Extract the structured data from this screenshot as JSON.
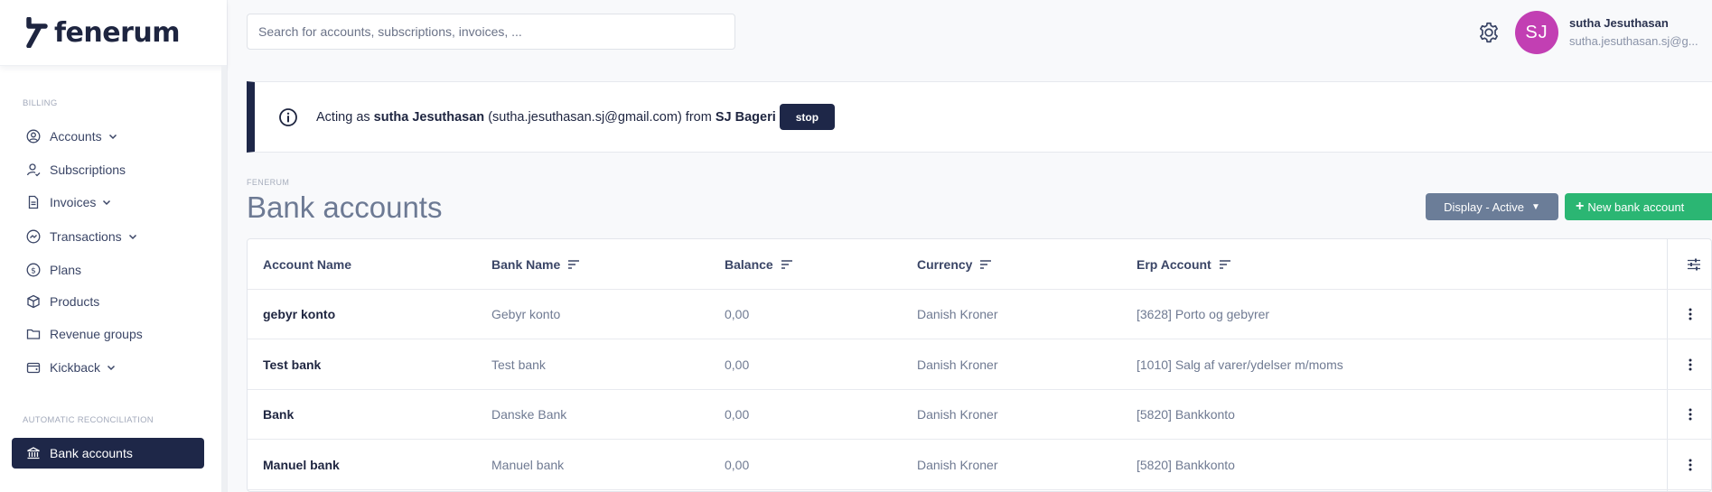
{
  "app": {
    "logo_text": "fenerum",
    "brand_color": "#1e2748",
    "accent_green": "#2bb673",
    "avatar_color": "#c23fb3"
  },
  "search": {
    "placeholder": "Search for accounts, subscriptions, invoices, ..."
  },
  "user": {
    "initials": "SJ",
    "name": "sutha Jesuthasan",
    "email": "sutha.jesuthasan.sj@g..."
  },
  "sidebar": {
    "billing_label": "BILLING",
    "reconciliation_label": "AUTOMATIC RECONCILIATION",
    "items": [
      {
        "label": "Accounts",
        "icon": "user-circle-icon",
        "has_chevron": true
      },
      {
        "label": "Subscriptions",
        "icon": "user-check-icon",
        "has_chevron": false
      },
      {
        "label": "Invoices",
        "icon": "document-icon",
        "has_chevron": true
      },
      {
        "label": "Transactions",
        "icon": "transactions-icon",
        "has_chevron": true
      },
      {
        "label": "Plans",
        "icon": "dollar-circle-icon",
        "has_chevron": false
      },
      {
        "label": "Products",
        "icon": "box-icon",
        "has_chevron": false
      },
      {
        "label": "Revenue groups",
        "icon": "folder-icon",
        "has_chevron": false
      },
      {
        "label": "Kickback",
        "icon": "wallet-icon",
        "has_chevron": true
      }
    ],
    "active_item": {
      "label": "Bank accounts",
      "icon": "bank-icon"
    }
  },
  "banner": {
    "prefix": "Acting as ",
    "acting_user": "sutha Jesuthasan",
    "email_part": " (sutha.jesuthasan.sj@gmail.com) from ",
    "company": "SJ Bageri",
    "stop_label": "stop"
  },
  "page": {
    "breadcrumb": "FENERUM",
    "title": "Bank accounts",
    "display_button": "Display - Active",
    "new_button": "New bank account"
  },
  "table": {
    "headers": {
      "account_name": "Account Name",
      "bank_name": "Bank Name",
      "balance": "Balance",
      "currency": "Currency",
      "erp_account": "Erp Account"
    },
    "rows": [
      {
        "account_name": "gebyr konto",
        "bank_name": "Gebyr konto",
        "balance": "0,00",
        "currency": "Danish Kroner",
        "erp_account": "[3628] Porto og gebyrer"
      },
      {
        "account_name": "Test bank",
        "bank_name": "Test bank",
        "balance": "0,00",
        "currency": "Danish Kroner",
        "erp_account": "[1010] Salg af varer/ydelser m/moms"
      },
      {
        "account_name": "Bank",
        "bank_name": "Danske Bank",
        "balance": "0,00",
        "currency": "Danish Kroner",
        "erp_account": "[5820] Bankkonto"
      },
      {
        "account_name": "Manuel bank",
        "bank_name": "Manuel bank",
        "balance": "0,00",
        "currency": "Danish Kroner",
        "erp_account": "[5820] Bankkonto"
      }
    ]
  }
}
